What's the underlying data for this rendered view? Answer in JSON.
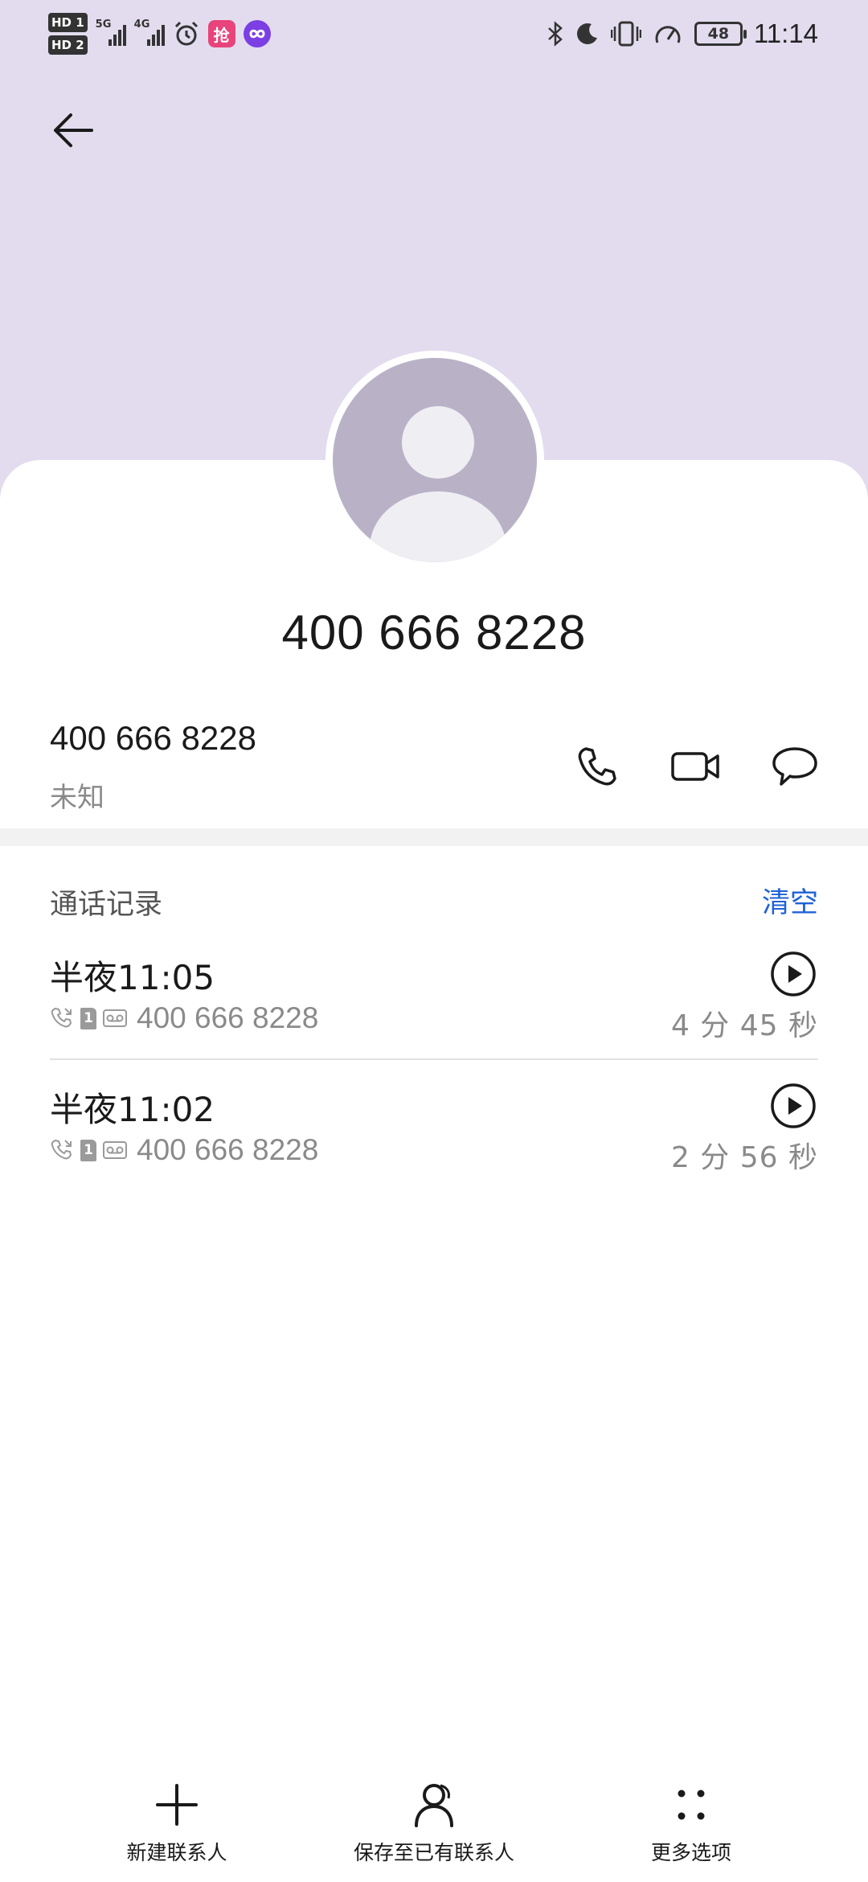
{
  "colors": {
    "header_bg": "#e2dcee",
    "avatar_bg": "#b9b2c7",
    "accent_blue": "#1f62d6",
    "app_badge_pink": "#e8437a",
    "app_badge_purple": "#7b3fe4"
  },
  "status_bar": {
    "sim1_label": "HD 1",
    "sim2_label": "HD 2",
    "network1": "5G",
    "network2": "4G",
    "pink_app_char": "抢",
    "battery": "48",
    "time": "11:14",
    "icons": [
      "alarm-icon",
      "bluetooth-icon",
      "moon-icon",
      "vibrate-icon",
      "speed-icon"
    ]
  },
  "nav": {
    "back_icon": "arrow-left-icon"
  },
  "contact": {
    "display_name": "400 666 8228",
    "number": "400 666 8228",
    "location": "未知",
    "actions": [
      "phone-icon",
      "video-call-icon",
      "message-icon"
    ]
  },
  "call_log": {
    "title": "通话记录",
    "clear_label": "清空",
    "items": [
      {
        "time": "半夜11:05",
        "sim": "1",
        "number": "400 666 8228",
        "duration": "4 分 45 秒"
      },
      {
        "time": "半夜11:02",
        "sim": "1",
        "number": "400 666 8228",
        "duration": "2 分 56 秒"
      }
    ]
  },
  "bottom_bar": {
    "new_contact": "新建联系人",
    "save_existing": "保存至已有联系人",
    "more": "更多选项"
  }
}
